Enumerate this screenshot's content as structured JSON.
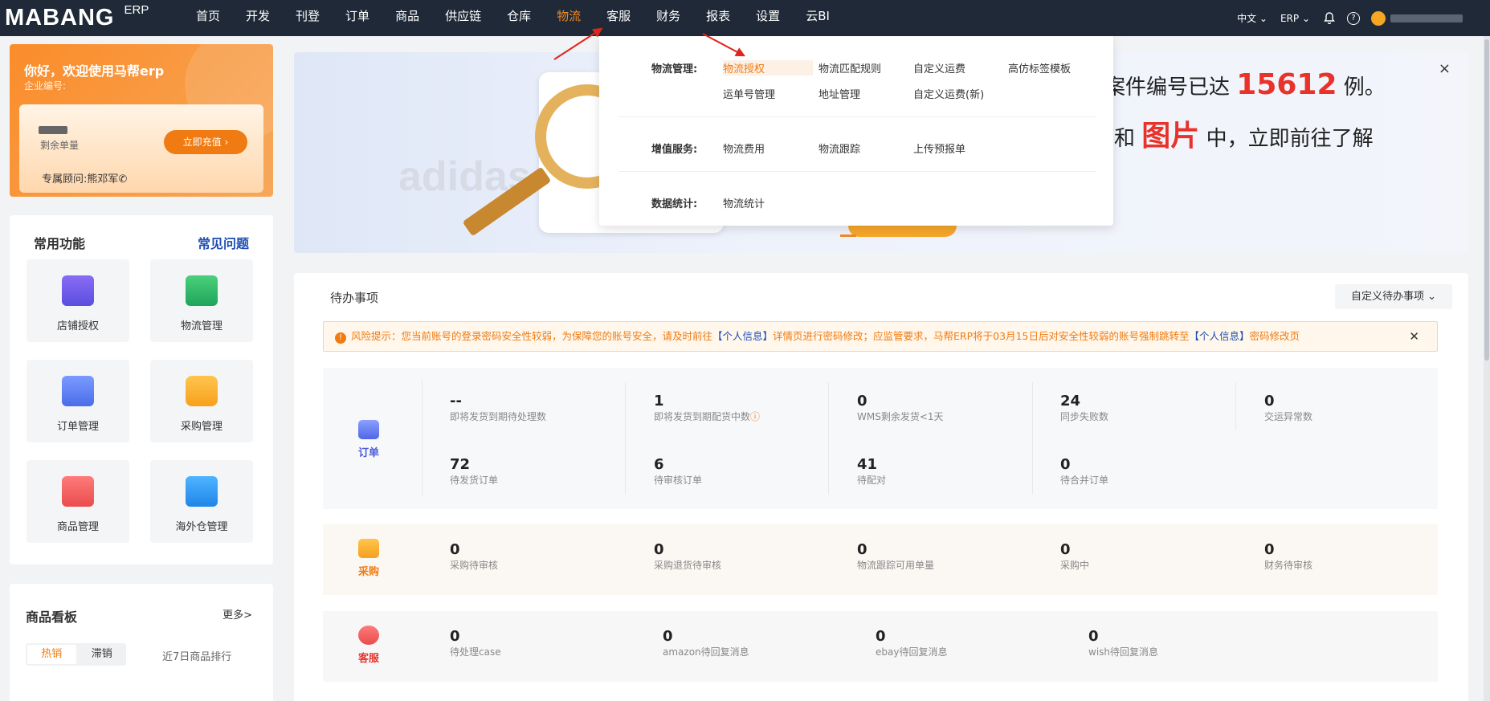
{
  "brand": {
    "wordmark": "MABANG",
    "suffix": "ERP"
  },
  "nav": [
    "首页",
    "开发",
    "刊登",
    "订单",
    "商品",
    "供应链",
    "仓库",
    "物流",
    "客服",
    "财务",
    "报表",
    "设置",
    "云BI"
  ],
  "nav_active_index": 7,
  "topright": {
    "lang": "中文",
    "product": "ERP"
  },
  "welcome": {
    "title": "你好，欢迎使用马帮erp",
    "company": "企业编号:",
    "remain_label": "剩余单量",
    "recharge": "立即充值",
    "advisor": "专属顾问:熊邓军"
  },
  "common": {
    "title": "常用功能",
    "faq": "常见问题",
    "tiles": [
      "店铺授权",
      "物流管理",
      "订单管理",
      "采购管理",
      "商品管理",
      "海外仓管理"
    ]
  },
  "board": {
    "title": "商品看板",
    "more": "更多>",
    "tabs": [
      "热销",
      "滞销"
    ],
    "rank": "近7日商品排行"
  },
  "banner": {
    "line1_a": "案件编号已达",
    "line1_num": "15612",
    "line1_b": "例。",
    "line2_a": "和",
    "line2_red": "图片",
    "line2_b": "中，立即前往了解",
    "brand_bg": "adidas",
    "close": "×"
  },
  "dropdown": {
    "groups": [
      {
        "title": "物流管理:",
        "links": [
          "物流授权",
          "物流匹配规则",
          "自定义运费",
          "高仿标签模板",
          "运单号管理",
          "地址管理",
          "自定义运费(新)"
        ]
      },
      {
        "title": "增值服务:",
        "links": [
          "物流费用",
          "物流跟踪",
          "上传预报单"
        ]
      },
      {
        "title": "数据统计:",
        "links": [
          "物流统计"
        ]
      }
    ]
  },
  "todo": {
    "title": "待办事项",
    "custom": "自定义待办事项",
    "warn": {
      "pre": "风险提示：您当前账号的登录密码安全性较弱，为保障您的账号安全，请及时前往",
      "link1": "【个人信息】",
      "mid": "详情页进行密码修改；应监管要求，马帮ERP将于03月15日后对安全性较弱的账号强制跳转至",
      "link2": "【个人信息】",
      "post": "密码修改页"
    },
    "order": {
      "label": "订单",
      "row1": [
        {
          "v": "--",
          "l": "即将发货到期待处理数"
        },
        {
          "v": "1",
          "l": "即将发货到期配货中数"
        },
        {
          "v": "0",
          "l": "WMS剩余发货<1天"
        },
        {
          "v": "24",
          "l": "同步失败数"
        },
        {
          "v": "0",
          "l": "交运异常数"
        }
      ],
      "row2": [
        {
          "v": "72",
          "l": "待发货订单"
        },
        {
          "v": "6",
          "l": "待审核订单"
        },
        {
          "v": "41",
          "l": "待配对"
        },
        {
          "v": "0",
          "l": "待合并订单"
        }
      ]
    },
    "purchase": {
      "label": "采购",
      "items": [
        {
          "v": "0",
          "l": "采购待审核"
        },
        {
          "v": "0",
          "l": "采购退货待审核"
        },
        {
          "v": "0",
          "l": "物流跟踪可用单量"
        },
        {
          "v": "0",
          "l": "采购中"
        },
        {
          "v": "0",
          "l": "财务待审核"
        }
      ]
    },
    "service": {
      "label": "客服",
      "items": [
        {
          "v": "0",
          "l": "待处理case"
        },
        {
          "v": "0",
          "l": "amazon待回复消息"
        },
        {
          "v": "0",
          "l": "ebay待回复消息"
        },
        {
          "v": "0",
          "l": "wish待回复消息"
        }
      ]
    }
  },
  "colors": {
    "accent": "#f07b12",
    "topbar": "#1f2937",
    "link": "#1f4fb3",
    "banner_red": "#e8322a",
    "arrow": "#e0251b"
  }
}
